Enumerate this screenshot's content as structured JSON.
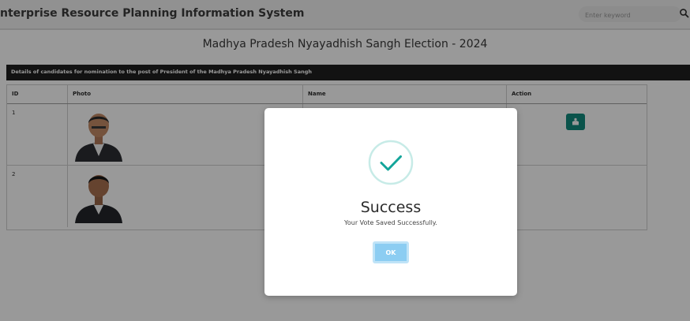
{
  "header": {
    "app_title": "nterprise Resource Planning Information System",
    "search_placeholder": "Enter keyword",
    "search_icon": "search-icon"
  },
  "page": {
    "election_title": "Madhya Pradesh Nyayadhish Sangh Election - 2024"
  },
  "table": {
    "title": "Details of candidates for nomination to the post of President of the Madhya Pradesh Nyayadhish Sangh",
    "columns": [
      "ID",
      "Photo",
      "Name",
      "Action"
    ],
    "rows": [
      {
        "id": "1",
        "name": "",
        "action_icon": "vote-icon"
      },
      {
        "id": "2",
        "name": "",
        "action_icon": ""
      }
    ],
    "action_color": "#128a7e"
  },
  "modal": {
    "icon": "check-circle-icon",
    "title": "Success",
    "message": "Your Vote Saved Successfully.",
    "ok_label": "OK",
    "accent_color": "#8ccdf2",
    "check_color": "#14a59a"
  }
}
